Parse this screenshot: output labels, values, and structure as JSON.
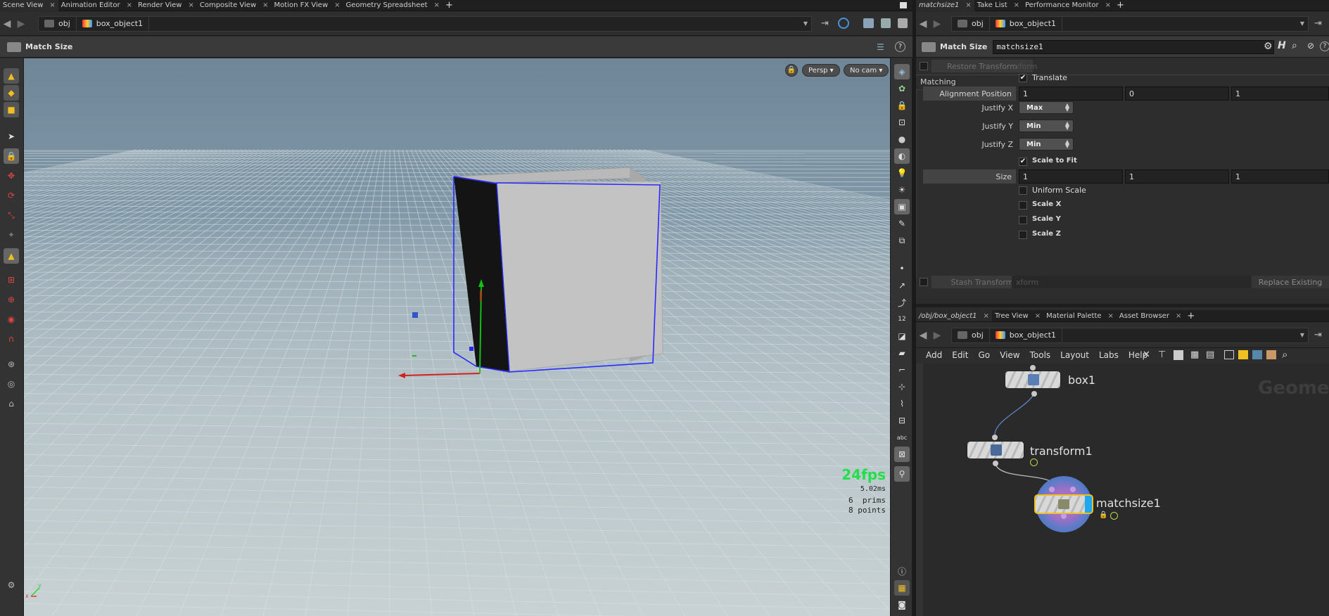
{
  "left_tabs": [
    {
      "label": "Scene View",
      "active": true
    },
    {
      "label": "Animation Editor"
    },
    {
      "label": "Render View"
    },
    {
      "label": "Composite View"
    },
    {
      "label": "Motion FX View"
    },
    {
      "label": "Geometry Spreadsheet"
    }
  ],
  "right_tabs": [
    {
      "label": "matchsize1",
      "active": true,
      "italic": true
    },
    {
      "label": "Take List"
    },
    {
      "label": "Performance Monitor"
    }
  ],
  "net_tabs": [
    {
      "label": "/obj/box_object1",
      "active": true,
      "italic": true
    },
    {
      "label": "Tree View"
    },
    {
      "label": "Material Palette"
    },
    {
      "label": "Asset Browser"
    }
  ],
  "close_glyph": "×",
  "plus_glyph": "+",
  "path": {
    "context": "obj",
    "node": "box_object1"
  },
  "viewport": {
    "tool_title": "Match Size",
    "persp_label": "Persp ▾",
    "cam_label": "No cam ▾",
    "fps": "24fps",
    "time": "5.02ms",
    "prims": "6  prims",
    "points": "8 points",
    "axis_x": "x",
    "axis_y": "y"
  },
  "parm": {
    "type": "Match Size",
    "name": "matchsize1",
    "restore_transform": "Restore Transform",
    "xform_placeholder": "xform",
    "matching_group": "Matching",
    "translate": "Translate",
    "alignment_position_label": "Alignment Position",
    "alignment_position": [
      "1",
      "0",
      "1"
    ],
    "justify_x_label": "Justify X",
    "justify_x": "Max",
    "justify_y_label": "Justify Y",
    "justify_y": "Min",
    "justify_z_label": "Justify Z",
    "justify_z": "Min",
    "scale_to_fit": "Scale to Fit",
    "size_label": "Size",
    "size": [
      "1",
      "1",
      "1"
    ],
    "uniform_scale": "Uniform Scale",
    "scale_x": "Scale X",
    "scale_y": "Scale Y",
    "scale_z": "Scale Z",
    "stash_transform": "Stash Transform",
    "stash_placeholder": "xform",
    "replace_existing": "Replace Existing",
    "check_glyph": "✔"
  },
  "network": {
    "menu": [
      "Add",
      "Edit",
      "Go",
      "View",
      "Tools",
      "Layout",
      "Labs",
      "Help"
    ],
    "watermark": "Geometr",
    "nodes": [
      "box1",
      "transform1",
      "matchsize1"
    ]
  },
  "colors": {
    "accent_yellow": "#f0c020",
    "select_blue": "#2a2aff",
    "flag_blue": "#1fa7f0"
  }
}
